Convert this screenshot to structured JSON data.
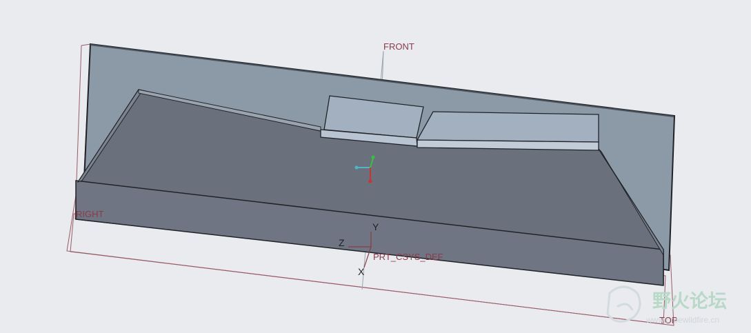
{
  "viewport": {
    "datum_planes": {
      "front": "FRONT",
      "right": "RIGHT",
      "top": "TOP"
    },
    "coordinate_system": {
      "name": "PRT_CSYS_DEF",
      "x_axis": "X",
      "y_axis": "Y",
      "z_axis": "Z"
    }
  },
  "watermark": {
    "title": "野火论坛",
    "url": "www.proewildfire.cn"
  },
  "colors": {
    "background": "#e9ebee",
    "datum_plane": "#8a3b4a",
    "shaded_face": "#6b717c",
    "back_wall": "#8c99a6",
    "highlight_face": "#a3b0c0"
  }
}
